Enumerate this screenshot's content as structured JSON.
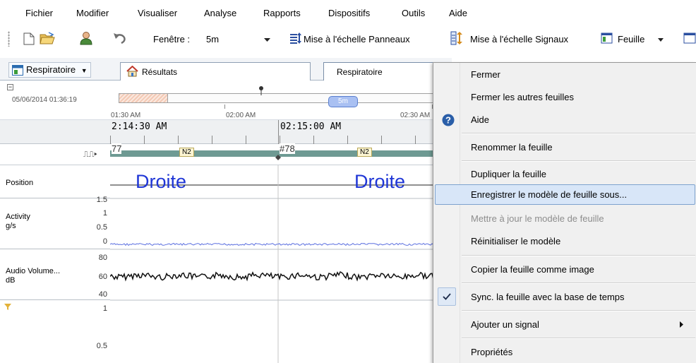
{
  "menubar": {
    "items": [
      "Fichier",
      "Modifier",
      "Visualiser",
      "Analyse",
      "Rapports",
      "Dispositifs",
      "Outils",
      "Aide"
    ]
  },
  "toolbar": {
    "window_label": "Fenêtre :",
    "window_value": "5m",
    "scale_panels_label": "Mise à l'échelle Panneaux",
    "scale_signals_label": "Mise à l'échelle Signaux",
    "sheet_label": "Feuille"
  },
  "tabs": {
    "sheet_selector": "Respiratoire",
    "results_tab": "Résultats",
    "respiratory_tab": "Respiratoire"
  },
  "overview": {
    "date": "05/06/2014 01:36:19",
    "window_badge": "5m",
    "tick_labels": [
      "01:30 AM",
      "02:00 AM",
      "02:30 AM"
    ]
  },
  "timeruler": {
    "labels": [
      "2:14:30 AM",
      "02:15:00 AM"
    ]
  },
  "hypnogram": {
    "epochs": [
      "77",
      "#78"
    ],
    "stages": [
      "N2",
      "N2"
    ]
  },
  "channels": {
    "position": {
      "name": "Position",
      "values": [
        "Droite",
        "Droite"
      ]
    },
    "activity": {
      "name": "Activity",
      "unit": "g/s",
      "ticks": [
        "1.5",
        "1",
        "0.5",
        "0"
      ]
    },
    "audio": {
      "name": "Audio Volume...",
      "unit": "dB",
      "ticks": [
        "80",
        "60",
        "40"
      ]
    },
    "bottom": {
      "ticks": [
        "1",
        "0.5"
      ]
    }
  },
  "context_menu": {
    "items": [
      {
        "label": "Fermer",
        "disabled": false
      },
      {
        "label": "Fermer les autres feuilles",
        "disabled": false
      },
      {
        "label": "Aide",
        "disabled": false
      },
      {
        "label": "Renommer la feuille",
        "disabled": false
      },
      {
        "label": "Dupliquer la feuille",
        "disabled": false
      },
      {
        "label": "Enregistrer le modèle de feuille sous...",
        "disabled": false
      },
      {
        "label": "Mettre à jour le modèle de feuille",
        "disabled": true
      },
      {
        "label": "Réinitialiser le modèle",
        "disabled": false
      },
      {
        "label": "Copier la feuille comme image",
        "disabled": false
      },
      {
        "label": "Sync. la feuille avec la base de temps",
        "disabled": false
      },
      {
        "label": "Ajouter un signal",
        "disabled": false
      },
      {
        "label": "Propriétés",
        "disabled": false
      }
    ]
  },
  "colors": {
    "accent_blue": "#1f36d6",
    "hypno_bar": "#6e9a93",
    "menu_highlight": "#d8e6f8"
  }
}
